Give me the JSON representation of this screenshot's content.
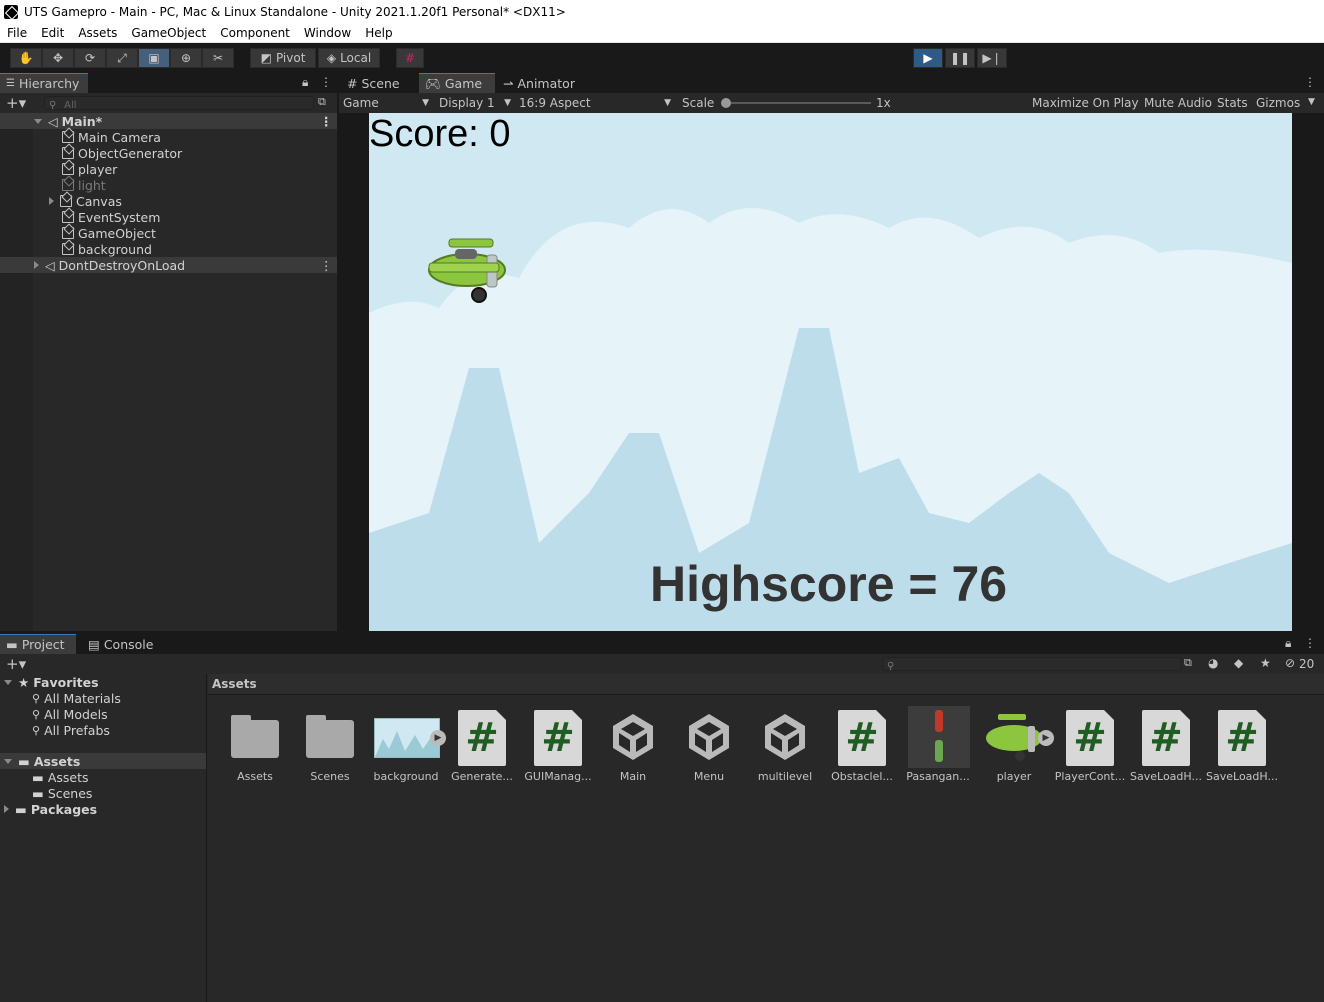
{
  "window": {
    "title": "UTS Gamepro - Main - PC, Mac & Linux Standalone - Unity 2021.1.20f1 Personal* <DX11>"
  },
  "menu": [
    "File",
    "Edit",
    "Assets",
    "GameObject",
    "Component",
    "Window",
    "Help"
  ],
  "toolbar": {
    "pivot": "Pivot",
    "local": "Local"
  },
  "hierarchy": {
    "tab": "Hierarchy",
    "search_placeholder": "All",
    "scene": "Main*",
    "items": [
      "Main Camera",
      "ObjectGenerator",
      "player",
      "light",
      "Canvas",
      "EventSystem",
      "GameObject",
      "background"
    ],
    "dontdestroy": "DontDestroyOnLoad"
  },
  "viewtabs": {
    "scene": "Scene",
    "game": "Game",
    "animator": "Animator"
  },
  "gamebar": {
    "mode": "Game",
    "display": "Display 1",
    "aspect": "16:9 Aspect",
    "scale_label": "Scale",
    "scale_value": "1x",
    "maximize": "Maximize On Play",
    "mute": "Mute Audio",
    "stats": "Stats",
    "gizmos": "Gizmos"
  },
  "game": {
    "score": "Score: 0",
    "highscore": "Highscore = 76"
  },
  "bottom": {
    "project_tab": "Project",
    "console_tab": "Console",
    "hidden_count": "20"
  },
  "project_tree": {
    "favorites": "Favorites",
    "fav_items": [
      "All Materials",
      "All Models",
      "All Prefabs"
    ],
    "assets": "Assets",
    "asset_items": [
      "Assets",
      "Scenes"
    ],
    "packages": "Packages"
  },
  "breadcrumb": "Assets",
  "assets": [
    {
      "label": "Assets",
      "kind": "folder"
    },
    {
      "label": "Scenes",
      "kind": "folder"
    },
    {
      "label": "background",
      "kind": "image"
    },
    {
      "label": "Generate...",
      "kind": "script"
    },
    {
      "label": "GUIManag...",
      "kind": "script"
    },
    {
      "label": "Main",
      "kind": "scene"
    },
    {
      "label": "Menu",
      "kind": "scene"
    },
    {
      "label": "multilevel",
      "kind": "scene"
    },
    {
      "label": "Obstaclel...",
      "kind": "script"
    },
    {
      "label": "Pasangan...",
      "kind": "sprite"
    },
    {
      "label": "player",
      "kind": "sprite"
    },
    {
      "label": "PlayerCont...",
      "kind": "script"
    },
    {
      "label": "SaveLoadH...",
      "kind": "script"
    },
    {
      "label": "SaveLoadH...",
      "kind": "script"
    }
  ]
}
